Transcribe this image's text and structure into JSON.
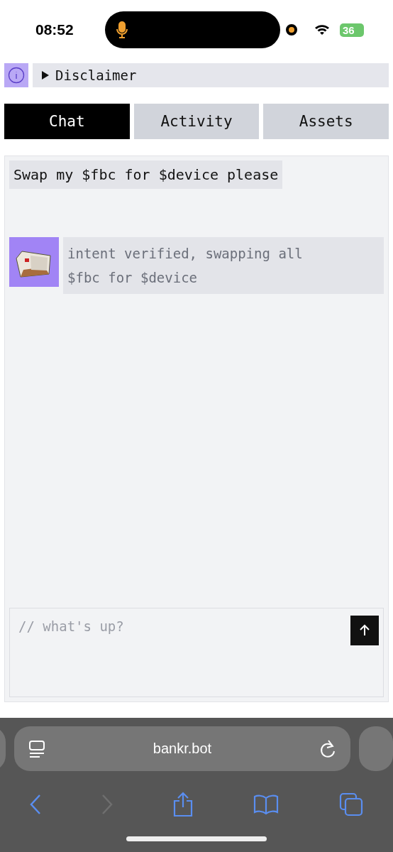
{
  "status_bar": {
    "time": "08:52",
    "battery": "36",
    "mic_active": true
  },
  "disclaimer": {
    "label": "Disclaimer",
    "expanded": false
  },
  "tabs": [
    {
      "label": "Chat",
      "selected": true
    },
    {
      "label": "Activity",
      "selected": false
    },
    {
      "label": "Assets",
      "selected": false
    }
  ],
  "messages": [
    {
      "kind": "user",
      "text": "Swap my $fbc for $device please"
    },
    {
      "kind": "bot",
      "text": "intent verified, swapping all $fbc for $device"
    }
  ],
  "composer": {
    "placeholder": "// what's up?"
  },
  "browser": {
    "url": "bankr.bot"
  }
}
